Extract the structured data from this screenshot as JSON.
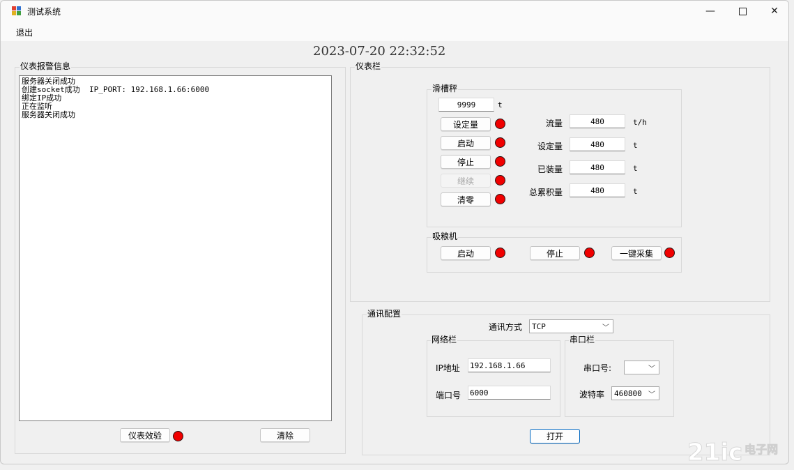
{
  "window": {
    "title": "测试系统"
  },
  "menu": {
    "exit": "退出"
  },
  "clock": "2023-07-20  22:32:52",
  "alarm_panel": {
    "title": "仪表报警信息",
    "log_lines": [
      "服务器关闭成功",
      "创建socket成功  IP_PORT: 192.168.1.66:6000",
      "绑定IP成功",
      "正在监听",
      "服务器关闭成功"
    ],
    "calibrate_label": "仪表效验",
    "clear_label": "清除"
  },
  "instrument_panel": {
    "title": "仪表栏",
    "scale": {
      "title": "滑槽秤",
      "target_value": "9999",
      "target_unit": "t",
      "buttons": [
        "设定量",
        "启动",
        "停止",
        "继续",
        "清零"
      ],
      "readings": [
        {
          "label": "流量",
          "value": "480",
          "unit": "t/h"
        },
        {
          "label": "设定量",
          "value": "480",
          "unit": "t"
        },
        {
          "label": "已装量",
          "value": "480",
          "unit": "t"
        },
        {
          "label": "总累积量",
          "value": "480",
          "unit": "t"
        }
      ]
    },
    "grain_machine": {
      "title": "吸粮机",
      "buttons": [
        "启动",
        "停止",
        "一键采集"
      ]
    }
  },
  "comm_panel": {
    "title": "通讯配置",
    "mode_label": "通讯方式",
    "mode_value": "TCP",
    "network": {
      "title": "网络栏",
      "ip_label": "IP地址",
      "ip_value": "192.168.1.66",
      "port_label": "端口号",
      "port_value": "6000"
    },
    "serial": {
      "title": "串口栏",
      "port_label": "串口号:",
      "port_value": "",
      "baud_label": "波特率",
      "baud_value": "460800"
    },
    "open_label": "打开"
  },
  "watermark": {
    "brand": "21ic",
    "text": "电子网"
  },
  "colors": {
    "led": "#f00000",
    "accent": "#0067c0"
  }
}
